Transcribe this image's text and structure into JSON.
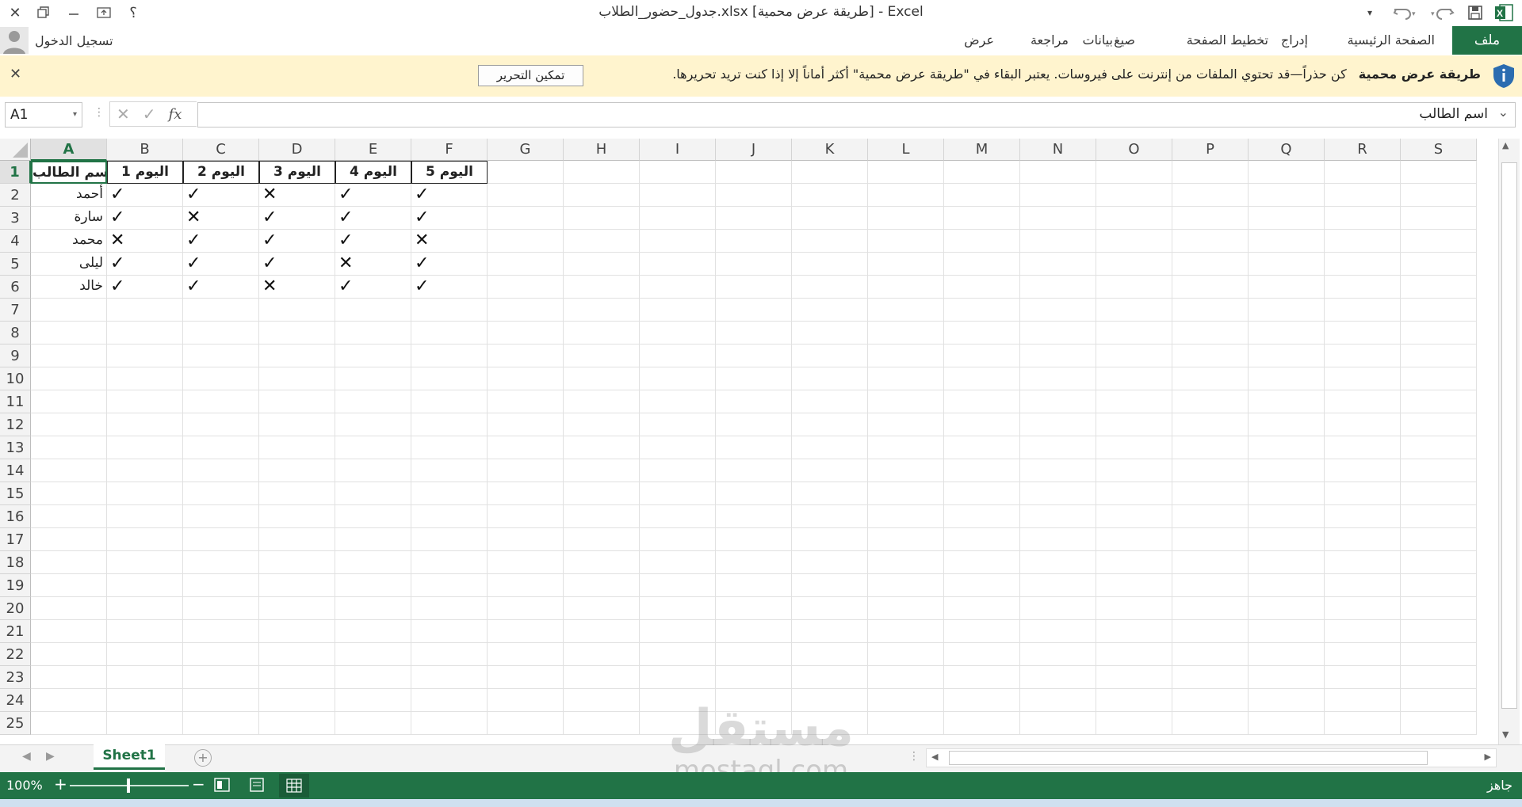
{
  "app": {
    "window_title": "جدول_حضور_الطلاب.xlsx  [طريقة عرض محمية] - Excel",
    "help_label": "؟",
    "sign_in": "تسجيل الدخول"
  },
  "ribbon": {
    "tabs": [
      "ملف",
      "الصفحة الرئيسية",
      "إدراج",
      "تخطيط الصفحة",
      "صيغ",
      "بيانات",
      "مراجعة",
      "عرض"
    ]
  },
  "protected_view": {
    "title": "طريقة عرض محمية",
    "message": "كن حذراً—قد تحتوي الملفات من إنترنت على فيروسات. يعتبر البقاء في \"طريقة عرض محمية\" أكثر أماناً إلا إذا كنت تريد تحريرها.",
    "button": "تمكين التحرير"
  },
  "formula_bar": {
    "name_box": "A1",
    "fx": "fx",
    "content": "اسم الطالب"
  },
  "grid": {
    "columns": [
      "A",
      "B",
      "C",
      "D",
      "E",
      "F",
      "G",
      "H",
      "I",
      "J",
      "K",
      "L",
      "M",
      "N",
      "O",
      "P",
      "Q",
      "R",
      "S"
    ],
    "rows": [
      "1",
      "2",
      "3",
      "4",
      "5",
      "6",
      "7",
      "8",
      "9",
      "10",
      "11",
      "12",
      "13",
      "14",
      "15",
      "16",
      "17",
      "18",
      "19",
      "20",
      "21",
      "22",
      "23",
      "24",
      "25"
    ],
    "header": [
      "اسم الطالب",
      "اليوم 1",
      "اليوم 2",
      "اليوم 3",
      "اليوم 4",
      "اليوم 5"
    ],
    "data": [
      [
        "أحمد",
        "✓",
        "✓",
        "✕",
        "✓",
        "✓"
      ],
      [
        "سارة",
        "✓",
        "✕",
        "✓",
        "✓",
        "✓"
      ],
      [
        "محمد",
        "✕",
        "✓",
        "✓",
        "✓",
        "✕"
      ],
      [
        "ليلى",
        "✓",
        "✓",
        "✓",
        "✕",
        "✓"
      ],
      [
        "خالد",
        "✓",
        "✓",
        "✕",
        "✓",
        "✓"
      ]
    ]
  },
  "sheets": [
    "Sheet1"
  ],
  "status": {
    "ready": "جاهز",
    "zoom": "100%"
  },
  "watermark": {
    "arabic": "مستقل",
    "latin": "mostaql.com"
  },
  "colors": {
    "excel_green": "#217346",
    "pv_bar": "#fff4ce",
    "info_blue": "#2b6cb0"
  }
}
